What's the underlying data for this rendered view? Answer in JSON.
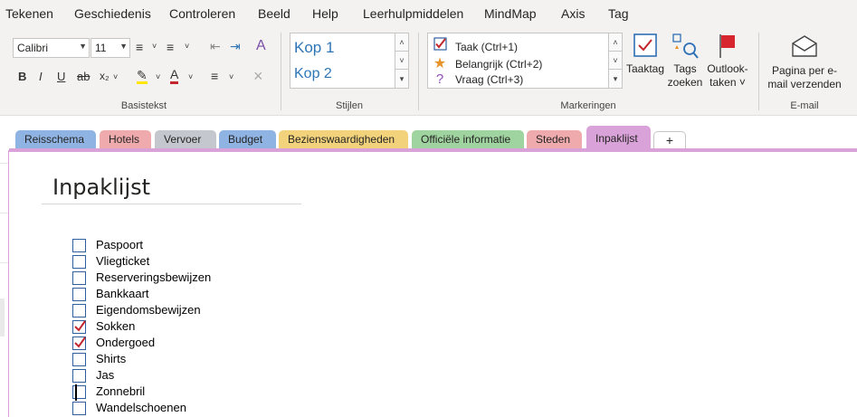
{
  "menubar": {
    "items": [
      "Tekenen",
      "Geschiedenis",
      "Controleren",
      "Beeld",
      "Help",
      "Leerhulpmiddelen",
      "MindMap",
      "Axis",
      "Tag"
    ]
  },
  "ribbon": {
    "basic_text": {
      "label": "Basistekst",
      "font_name": "Calibri",
      "font_size": "11"
    },
    "styles": {
      "label": "Stijlen",
      "items": [
        "Kop 1",
        "Kop 2"
      ]
    },
    "tags": {
      "label": "Markeringen",
      "items": [
        {
          "label": "Taak (Ctrl+1)",
          "icon": "checkbox-red-check-icon"
        },
        {
          "label": "Belangrijk (Ctrl+2)",
          "icon": "star-icon"
        },
        {
          "label": "Vraag (Ctrl+3)",
          "icon": "question-icon"
        }
      ],
      "todo_button": "Taaktag",
      "find_tags_line1": "Tags",
      "find_tags_line2": "zoeken",
      "outlook_line1": "Outlook-",
      "outlook_line2": "taken ˅"
    },
    "email": {
      "label": "E-mail",
      "button_line1": "Pagina per e-",
      "button_line2": "mail verzenden"
    }
  },
  "sections": [
    {
      "label": "Reisschema",
      "color": "#8fb4e3"
    },
    {
      "label": "Hotels",
      "color": "#efaaad"
    },
    {
      "label": "Vervoer",
      "color": "#c4c8ce"
    },
    {
      "label": "Budget",
      "color": "#8fb4e3"
    },
    {
      "label": "Bezienswaardigheden",
      "color": "#f2d27b"
    },
    {
      "label": "Officiële informatie",
      "color": "#9fd39f"
    },
    {
      "label": "Steden",
      "color": "#efaaad"
    },
    {
      "label": "Inpaklijst",
      "color": "#d9a3d9",
      "active": true
    }
  ],
  "add_section": "+",
  "page": {
    "title": "Inpaklijst",
    "checklist": [
      {
        "label": "Paspoort",
        "checked": false
      },
      {
        "label": "Vliegticket",
        "checked": false
      },
      {
        "label": "Reserveringsbewijzen",
        "checked": false
      },
      {
        "label": "Bankkaart",
        "checked": false
      },
      {
        "label": "Eigendomsbewijzen",
        "checked": false
      },
      {
        "label": "Sokken",
        "checked": true
      },
      {
        "label": "Ondergoed",
        "checked": true
      },
      {
        "label": "Shirts",
        "checked": false
      },
      {
        "label": "Jas",
        "checked": false
      },
      {
        "label": "Zonnebril",
        "checked": false
      },
      {
        "label": "Wandelschoenen",
        "checked": false
      }
    ]
  },
  "colors": {
    "accent_purple": "#d9a3d9",
    "check_red": "#c4262e",
    "box_blue": "#2f5f9e"
  }
}
